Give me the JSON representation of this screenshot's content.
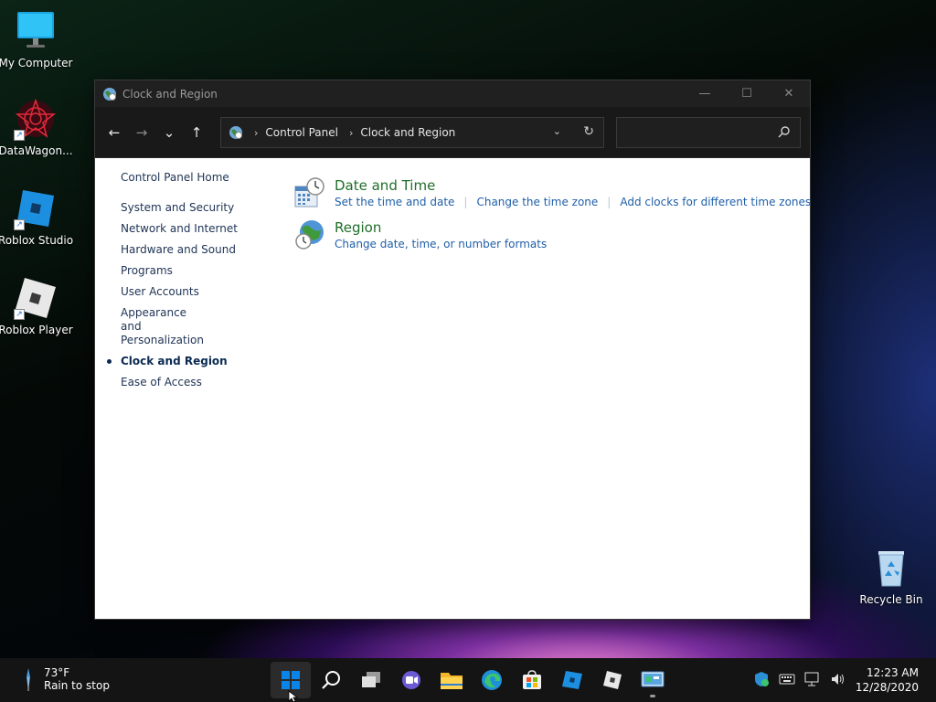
{
  "desktop": {
    "icons": [
      {
        "label": "My Computer"
      },
      {
        "label": "DataWagon..."
      },
      {
        "label": "Roblox Studio"
      },
      {
        "label": "Roblox Player"
      },
      {
        "label": "Recycle Bin"
      }
    ]
  },
  "window": {
    "title": "Clock and Region",
    "buttons": {
      "minimize": "—",
      "maximize": "☐",
      "close": "✕"
    },
    "nav": {
      "back": "←",
      "forward": "→",
      "recent": "⌄",
      "up": "↑"
    },
    "address": {
      "crumbs": [
        "Control Panel",
        "Clock and Region"
      ],
      "separator": "›",
      "dropdown": "⌄",
      "refresh": "↻"
    },
    "search": {
      "placeholder": ""
    },
    "sidebar": {
      "home": "Control Panel Home",
      "items": [
        "System and Security",
        "Network and Internet",
        "Hardware and Sound",
        "Programs",
        "User Accounts",
        "Appearance and Personalization",
        "Clock and Region",
        "Ease of Access"
      ],
      "active_index": 6
    },
    "categories": [
      {
        "title": "Date and Time",
        "icon": "calendar-clock-icon",
        "links": [
          "Set the time and date",
          "Change the time zone",
          "Add clocks for different time zones"
        ]
      },
      {
        "title": "Region",
        "icon": "globe-clock-icon",
        "links": [
          "Change date, time, or number formats"
        ]
      }
    ]
  },
  "taskbar": {
    "weather": {
      "temp": "73°F",
      "desc": "Rain to stop"
    },
    "apps": [
      "start-icon",
      "search-icon",
      "task-view-icon",
      "chat-icon",
      "file-explorer-icon",
      "edge-icon",
      "store-icon",
      "roblox-studio-icon",
      "roblox-player-icon",
      "control-panel-icon"
    ],
    "clock": {
      "time": "12:23 AM",
      "date": "12/28/2020"
    }
  },
  "colors": {
    "accent": "#1f5fa8",
    "category_title": "#1f6e2a",
    "titlebar": "#202020",
    "taskbar": "#141414"
  }
}
